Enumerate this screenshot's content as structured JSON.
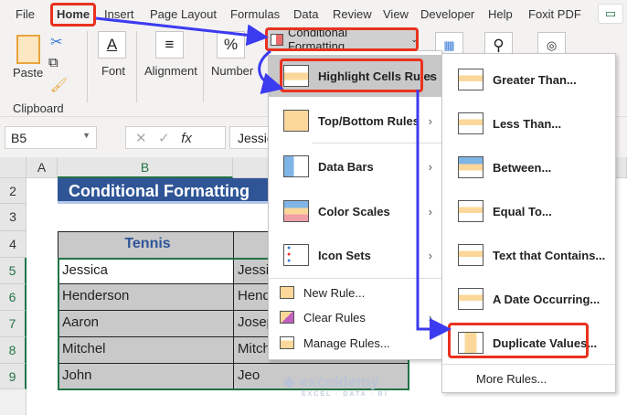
{
  "tabs": [
    "File",
    "Home",
    "Insert",
    "Page Layout",
    "Formulas",
    "Data",
    "Review",
    "View",
    "Developer",
    "Help",
    "Foxit PDF"
  ],
  "ribbon": {
    "paste": "Paste",
    "clipboard": "Clipboard",
    "font": "Font",
    "alignment": "Alignment",
    "number": "Number",
    "cf_button": "Conditional Formatting"
  },
  "formula_bar": {
    "name_box": "B5",
    "value": "Jessica"
  },
  "columns": [
    "A",
    "B"
  ],
  "rows": [
    "2",
    "3",
    "4",
    "5",
    "6",
    "7",
    "8",
    "9"
  ],
  "sheet": {
    "title": "Conditional Formatting",
    "header": "Tennis",
    "col_b": [
      "Jessica",
      "Henderson",
      "Aaron",
      "Mitchel",
      "John"
    ],
    "col_c": [
      "Jessica",
      "Henderson",
      "Joseph",
      "Mitchel",
      "Jeo"
    ]
  },
  "menu": {
    "items": [
      "Highlight Cells Rules",
      "Top/Bottom Rules",
      "Data Bars",
      "Color Scales",
      "Icon Sets"
    ],
    "small": [
      "New Rule...",
      "Clear Rules",
      "Manage Rules..."
    ]
  },
  "submenu": {
    "items": [
      "Greater Than...",
      "Less Than...",
      "Between...",
      "Equal To...",
      "Text that Contains...",
      "A Date Occurring...",
      "Duplicate Values..."
    ],
    "more": "More Rules..."
  },
  "watermark": "exceldemy EXCEL · DATA · BI",
  "colors": {
    "accent_red": "#e8321e",
    "arrow_blue": "#3b3bf0",
    "title_blue": "#2f5597",
    "excel_green": "#217346"
  }
}
